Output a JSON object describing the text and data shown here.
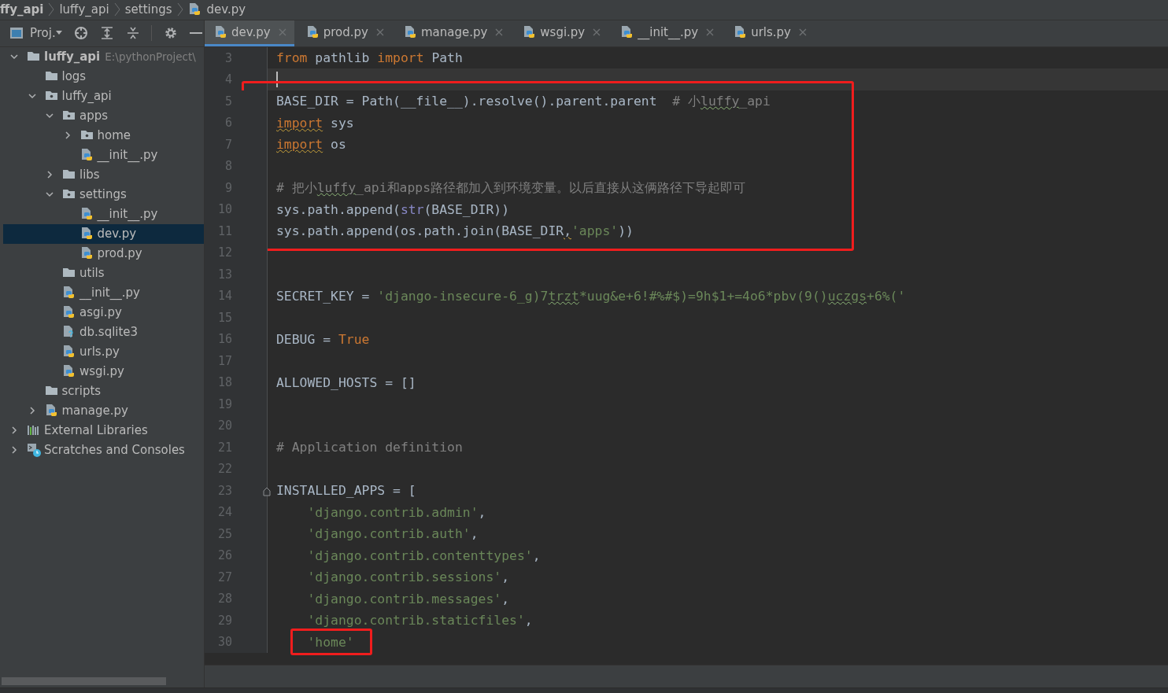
{
  "breadcrumbs": [
    {
      "label": "ffy_api",
      "bold": true,
      "kind": "module"
    },
    {
      "label": "luffy_api",
      "bold": false,
      "kind": "folder"
    },
    {
      "label": "settings",
      "bold": false,
      "kind": "folder"
    },
    {
      "label": "dev.py",
      "bold": false,
      "kind": "python"
    }
  ],
  "project_toolbar": {
    "label": "Proj."
  },
  "tree": [
    {
      "label": "luffy_api",
      "note": "E:\\pythonProject\\",
      "kind": "folder",
      "bold": true,
      "expanded": true,
      "selected": false,
      "children": [
        {
          "label": "logs",
          "kind": "folder",
          "selected": false
        },
        {
          "label": "luffy_api",
          "kind": "package",
          "expanded": true,
          "selected": false,
          "children": [
            {
              "label": "apps",
              "kind": "package",
              "expanded": true,
              "selected": false,
              "children": [
                {
                  "label": "home",
                  "kind": "package",
                  "expanded": false,
                  "selected": false
                },
                {
                  "label": "__init__.py",
                  "kind": "python",
                  "selected": false
                }
              ]
            },
            {
              "label": "libs",
              "kind": "folder",
              "expanded": false,
              "selected": false
            },
            {
              "label": "settings",
              "kind": "package",
              "expanded": true,
              "selected": false,
              "children": [
                {
                  "label": "__init__.py",
                  "kind": "python",
                  "selected": false
                },
                {
                  "label": "dev.py",
                  "kind": "python",
                  "selected": true
                },
                {
                  "label": "prod.py",
                  "kind": "python",
                  "selected": false
                }
              ]
            },
            {
              "label": "utils",
              "kind": "folder",
              "selected": false
            },
            {
              "label": "__init__.py",
              "kind": "python",
              "selected": false
            },
            {
              "label": "asgi.py",
              "kind": "python",
              "selected": false
            },
            {
              "label": "db.sqlite3",
              "kind": "unknown",
              "selected": false
            },
            {
              "label": "urls.py",
              "kind": "python",
              "selected": false
            },
            {
              "label": "wsgi.py",
              "kind": "python",
              "selected": false
            }
          ]
        },
        {
          "label": "scripts",
          "kind": "folder",
          "selected": false
        },
        {
          "label": "manage.py",
          "kind": "python",
          "expanded": false,
          "selected": false
        }
      ]
    },
    {
      "label": "External Libraries",
      "kind": "libraries",
      "expanded": false,
      "selected": false
    },
    {
      "label": "Scratches and Consoles",
      "kind": "scratches",
      "expanded": false,
      "selected": false
    }
  ],
  "tabs": [
    {
      "label": "dev.py",
      "selected": true
    },
    {
      "label": "prod.py",
      "selected": false
    },
    {
      "label": "manage.py",
      "selected": false
    },
    {
      "label": "wsgi.py",
      "selected": false
    },
    {
      "label": "__init__.py",
      "selected": false
    },
    {
      "label": "urls.py",
      "selected": false
    }
  ],
  "code": [
    {
      "kind": "line",
      "number": "3",
      "tokens": [
        {
          "kind": "keyword",
          "text": "from"
        },
        {
          "kind": "plain",
          "text": " pathlib "
        },
        {
          "kind": "keyword",
          "text": "import"
        },
        {
          "kind": "plain",
          "text": " Path"
        }
      ]
    },
    {
      "kind": "line",
      "number": "4",
      "caret": true
    },
    {
      "kind": "highlight",
      "lines": [
        {
          "kind": "line",
          "number": "5",
          "tokens": [
            {
              "kind": "plain",
              "text": "BASE_DIR = Path(__file__).resolve().parent.parent  "
            },
            {
              "kind": "comment",
              "text": "# 小"
            },
            {
              "kind": "comment",
              "text": "luffy",
              "warning": true
            },
            {
              "kind": "comment",
              "text": "_api"
            }
          ]
        },
        {
          "kind": "line",
          "number": "6",
          "tokens": [
            {
              "kind": "keyword",
              "text": "import",
              "warning": true
            },
            {
              "kind": "plain",
              "text": " sys"
            }
          ]
        },
        {
          "kind": "line",
          "number": "7",
          "tokens": [
            {
              "kind": "keyword",
              "text": "import",
              "warning": true
            },
            {
              "kind": "plain",
              "text": " os"
            }
          ]
        },
        {
          "kind": "line",
          "number": "8"
        },
        {
          "kind": "line",
          "number": "9",
          "tokens": [
            {
              "kind": "comment",
              "text": "# 把小"
            },
            {
              "kind": "comment",
              "text": "luffy",
              "warning": true
            },
            {
              "kind": "comment",
              "text": "_api和apps路径都加入到环境变量。以后直接从这俩路径下导起即可"
            }
          ]
        },
        {
          "kind": "line",
          "number": "10",
          "tokens": [
            {
              "kind": "plain",
              "text": "sys.path.append("
            },
            {
              "kind": "builtin",
              "text": "str"
            },
            {
              "kind": "plain",
              "text": "(BASE_DIR))"
            }
          ]
        },
        {
          "kind": "line",
          "number": "11",
          "tokens": [
            {
              "kind": "plain",
              "text": "sys.path.append(os.path.join(BASE_DIR"
            },
            {
              "kind": "plain",
              "text": ",",
              "warning": true
            },
            {
              "kind": "string",
              "text": "'apps'"
            },
            {
              "kind": "plain",
              "text": "))"
            }
          ]
        }
      ]
    },
    {
      "kind": "line",
      "number": "12"
    },
    {
      "kind": "line",
      "number": "13"
    },
    {
      "kind": "line",
      "number": "14",
      "tokens": [
        {
          "kind": "plain",
          "text": "SECRET_KEY = "
        },
        {
          "kind": "string",
          "text": "'django-insecure-6_g)7"
        },
        {
          "kind": "string",
          "text": "trzt",
          "warning": true
        },
        {
          "kind": "string",
          "text": "*uug&e+6!#%#$)=9h$1+=4o6*pbv(9()"
        },
        {
          "kind": "string",
          "text": "uczgs",
          "warning": true
        },
        {
          "kind": "string",
          "text": "+6%('"
        }
      ]
    },
    {
      "kind": "line",
      "number": "15"
    },
    {
      "kind": "line",
      "number": "16",
      "tokens": [
        {
          "kind": "plain",
          "text": "DEBUG = "
        },
        {
          "kind": "keyword",
          "text": "True"
        }
      ]
    },
    {
      "kind": "line",
      "number": "17"
    },
    {
      "kind": "line",
      "number": "18",
      "tokens": [
        {
          "kind": "plain",
          "text": "ALLOWED_HOSTS = []"
        }
      ]
    },
    {
      "kind": "line",
      "number": "19"
    },
    {
      "kind": "line",
      "number": "20"
    },
    {
      "kind": "line",
      "number": "21",
      "tokens": [
        {
          "kind": "comment",
          "text": "# Application definition"
        }
      ]
    },
    {
      "kind": "line",
      "number": "22"
    },
    {
      "kind": "line",
      "number": "23",
      "fold": true,
      "tokens": [
        {
          "kind": "plain",
          "text": "INSTALLED_APPS = ["
        }
      ]
    },
    {
      "kind": "line",
      "number": "24",
      "tokens": [
        {
          "kind": "string",
          "text": "    'django.contrib.admin'"
        },
        {
          "kind": "plain",
          "text": ","
        }
      ]
    },
    {
      "kind": "line",
      "number": "25",
      "tokens": [
        {
          "kind": "string",
          "text": "    'django.contrib.auth'"
        },
        {
          "kind": "plain",
          "text": ","
        }
      ]
    },
    {
      "kind": "line",
      "number": "26",
      "tokens": [
        {
          "kind": "string",
          "text": "    'django.contrib.contenttypes'"
        },
        {
          "kind": "plain",
          "text": ","
        }
      ]
    },
    {
      "kind": "line",
      "number": "27",
      "tokens": [
        {
          "kind": "string",
          "text": "    'django.contrib.sessions'"
        },
        {
          "kind": "plain",
          "text": ","
        }
      ]
    },
    {
      "kind": "line",
      "number": "28",
      "tokens": [
        {
          "kind": "string",
          "text": "    'django.contrib.messages'"
        },
        {
          "kind": "plain",
          "text": ","
        }
      ]
    },
    {
      "kind": "line",
      "number": "29",
      "tokens": [
        {
          "kind": "string",
          "text": "    'django.contrib.staticfiles'"
        },
        {
          "kind": "plain",
          "text": ","
        }
      ]
    },
    {
      "kind": "line",
      "number": "30",
      "tokens": [
        {
          "kind": "string",
          "text": "    'home'",
          "boxed": true
        }
      ]
    }
  ]
}
